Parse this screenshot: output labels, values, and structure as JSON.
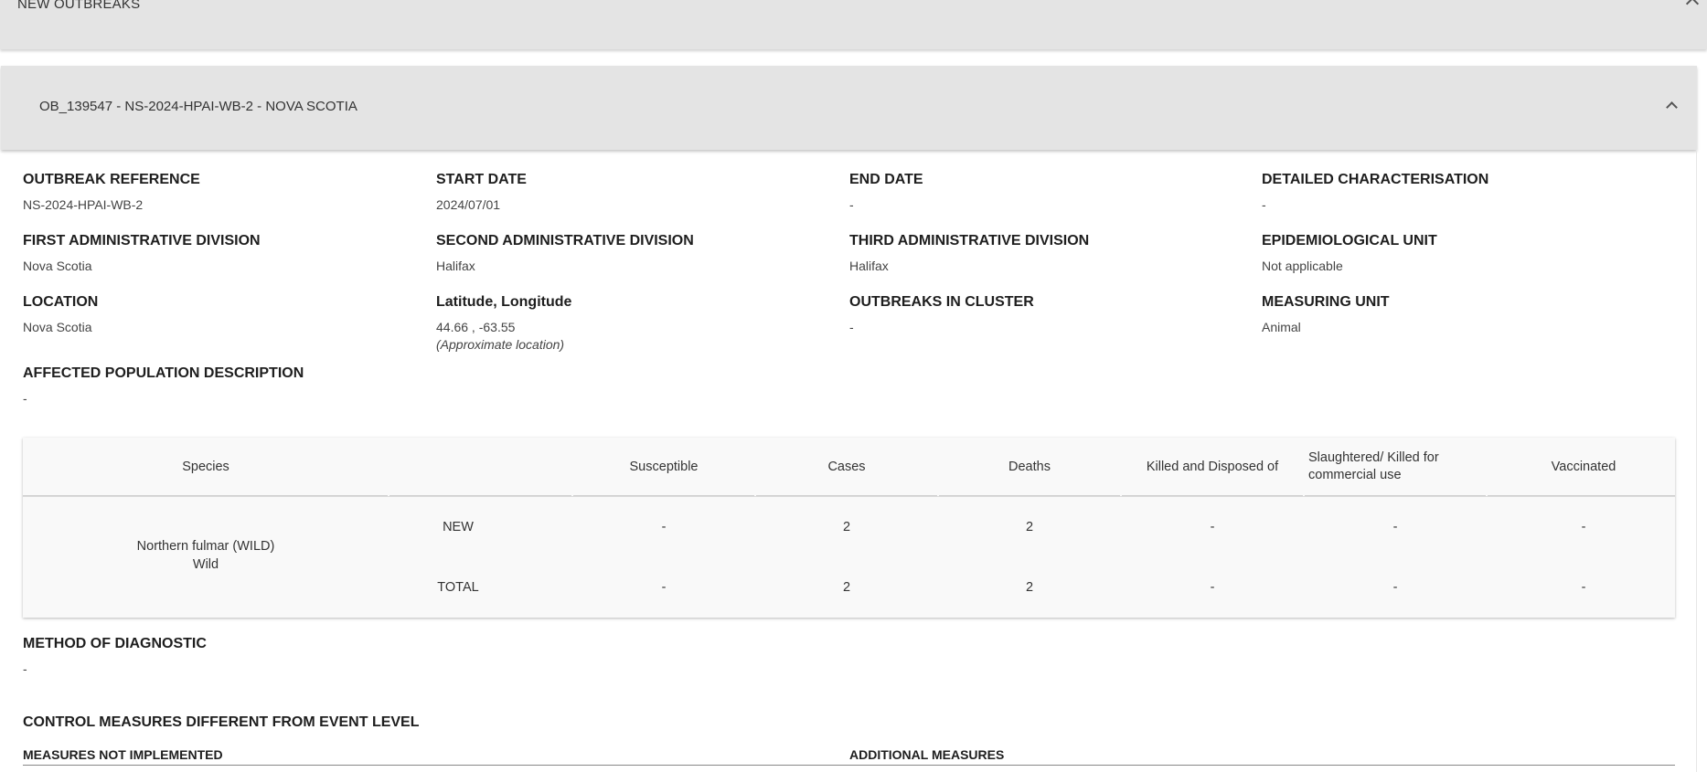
{
  "section": {
    "title": "NEW OUTBREAKS"
  },
  "outbreak": {
    "title": "OB_139547 - NS-2024-HPAI-WB-2 - NOVA SCOTIA",
    "fields": {
      "outbreak_reference": {
        "label": "OUTBREAK REFERENCE",
        "value": "NS-2024-HPAI-WB-2"
      },
      "start_date": {
        "label": "START DATE",
        "value": "2024/07/01"
      },
      "end_date": {
        "label": "END DATE",
        "value": "-"
      },
      "detailed_characterisation": {
        "label": "DETAILED CHARACTERISATION",
        "value": "-"
      },
      "first_admin_division": {
        "label": "FIRST ADMINISTRATIVE DIVISION",
        "value": "Nova Scotia"
      },
      "second_admin_division": {
        "label": "SECOND ADMINISTRATIVE DIVISION",
        "value": "Halifax"
      },
      "third_admin_division": {
        "label": "THIRD ADMINISTRATIVE DIVISION",
        "value": "Halifax"
      },
      "epidemiological_unit": {
        "label": "EPIDEMIOLOGICAL UNIT",
        "value": "Not applicable"
      },
      "location": {
        "label": "LOCATION",
        "value": "Nova Scotia"
      },
      "lat_long": {
        "label": "Latitude, Longitude",
        "value": "44.66 , -63.55",
        "note": "(Approximate location)"
      },
      "outbreaks_in_cluster": {
        "label": "OUTBREAKS IN CLUSTER",
        "value": "-"
      },
      "measuring_unit": {
        "label": "MEASURING UNIT",
        "value": "Animal"
      },
      "affected_population": {
        "label": "AFFECTED POPULATION DESCRIPTION",
        "value": "-"
      },
      "method_of_diagnostic": {
        "label": "METHOD OF DIAGNOSTIC",
        "value": "-"
      }
    },
    "species_table": {
      "headers": {
        "species": "Species",
        "susceptible": "Susceptible",
        "cases": "Cases",
        "deaths": "Deaths",
        "killed_disposed": "Killed and Disposed of",
        "slaughtered": "Slaughtered/ Killed for commercial use",
        "vaccinated": "Vaccinated"
      },
      "species_name": "Northern fulmar (WILD)",
      "species_type": "Wild",
      "rows": [
        {
          "label": "NEW",
          "susceptible": "-",
          "cases": "2",
          "deaths": "2",
          "killed_disposed": "-",
          "slaughtered": "-",
          "vaccinated": "-"
        },
        {
          "label": "TOTAL",
          "susceptible": "-",
          "cases": "2",
          "deaths": "2",
          "killed_disposed": "-",
          "slaughtered": "-",
          "vaccinated": "-"
        }
      ]
    },
    "control_measures": {
      "title": "CONTROL MEASURES DIFFERENT FROM EVENT LEVEL",
      "not_implemented_label": "MEASURES NOT IMPLEMENTED",
      "additional_label": "ADDITIONAL MEASURES"
    }
  }
}
